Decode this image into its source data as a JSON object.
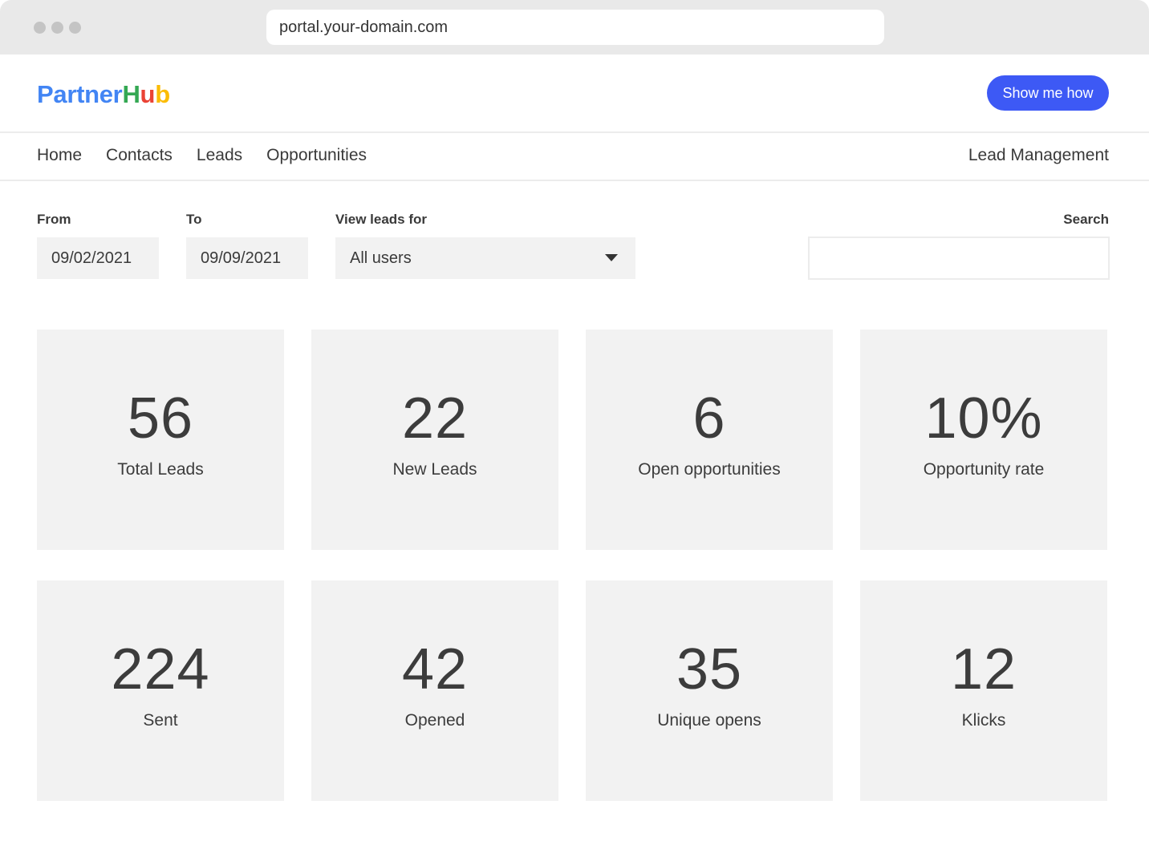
{
  "browser": {
    "url": "portal.your-domain.com"
  },
  "header": {
    "logo": {
      "part1": "Partner",
      "part2": "H",
      "part3": "u",
      "part4": "b"
    },
    "cta_label": "Show me how"
  },
  "nav": {
    "items": [
      {
        "label": "Home"
      },
      {
        "label": "Contacts"
      },
      {
        "label": "Leads"
      },
      {
        "label": "Opportunities"
      }
    ],
    "right_label": "Lead Management"
  },
  "filters": {
    "from_label": "From",
    "from_value": "09/02/2021",
    "to_label": "To",
    "to_value": "09/09/2021",
    "view_label": "View leads for",
    "view_value": "All users",
    "search_label": "Search",
    "search_value": ""
  },
  "stats": [
    {
      "value": "56",
      "label": "Total Leads"
    },
    {
      "value": "22",
      "label": "New Leads"
    },
    {
      "value": "6",
      "label": "Open opportunities"
    },
    {
      "value": "10%",
      "label": "Opportunity rate"
    },
    {
      "value": "224",
      "label": "Sent"
    },
    {
      "value": "42",
      "label": "Opened"
    },
    {
      "value": "35",
      "label": "Unique opens"
    },
    {
      "value": "12",
      "label": "Klicks"
    }
  ],
  "colors": {
    "accent": "#3d59f5",
    "logo_blue": "#4285f4",
    "logo_green": "#34a853",
    "logo_red": "#ea4335",
    "logo_yellow": "#fbbc05",
    "card_bg": "#f2f2f2"
  }
}
